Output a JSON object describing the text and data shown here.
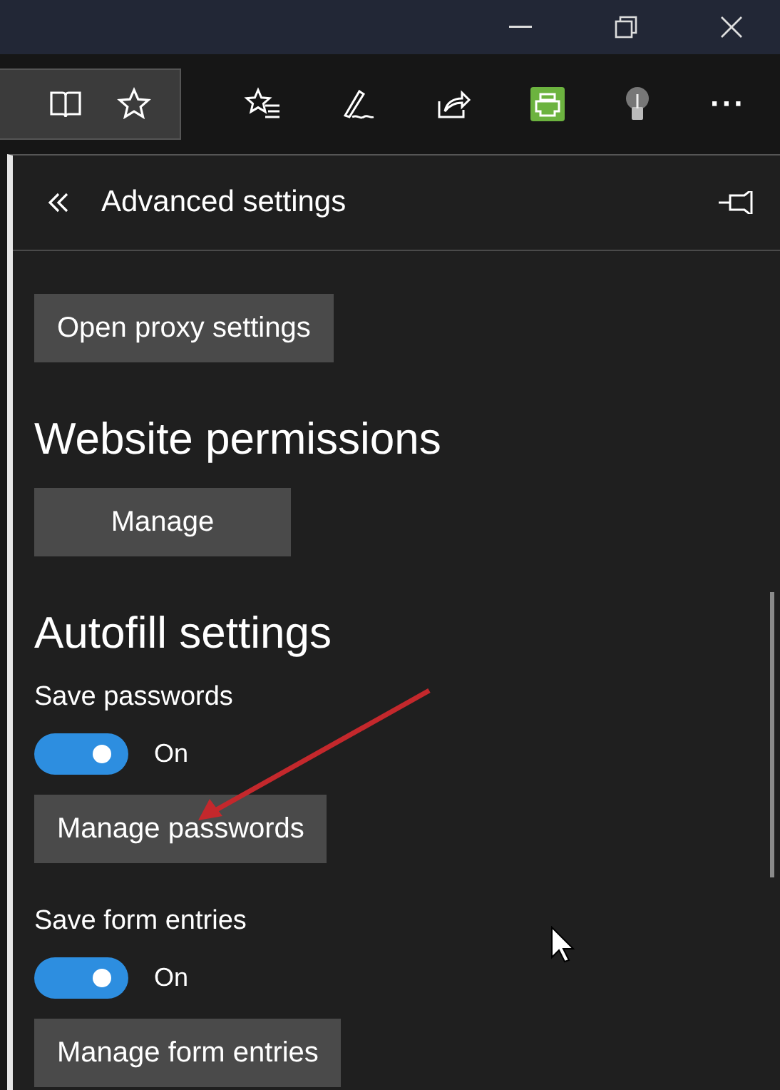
{
  "toolbar": {
    "more_label": "···"
  },
  "panel": {
    "title": "Advanced settings",
    "sections": [
      {
        "kind": "button",
        "label": "Open proxy settings"
      },
      {
        "kind": "heading",
        "label": "Website permissions"
      },
      {
        "kind": "button",
        "label": "Manage"
      },
      {
        "kind": "heading",
        "label": "Autofill settings"
      },
      {
        "kind": "label",
        "label": "Save passwords"
      },
      {
        "kind": "toggle",
        "on": true,
        "label": "On"
      },
      {
        "kind": "button",
        "label": "Manage passwords"
      },
      {
        "kind": "label",
        "label": "Save form entries"
      },
      {
        "kind": "toggle",
        "on": true,
        "label": "On"
      },
      {
        "kind": "button",
        "label": "Manage form entries"
      }
    ]
  }
}
